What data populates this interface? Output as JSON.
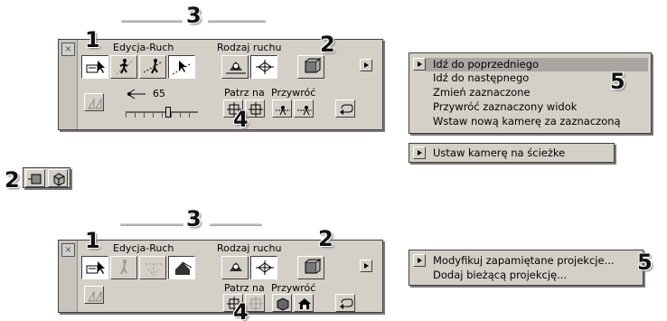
{
  "annotations": {
    "n1_top": "1",
    "n2_top": "2",
    "n3_top": "3",
    "n4_top": "4",
    "n5_top": "5",
    "n2_mid": "2",
    "n1_bot": "1",
    "n2_bot": "2",
    "n3_bot": "3",
    "n4_bot": "4",
    "n5_bot": "5"
  },
  "palette_top": {
    "group_edit": "Edycja-Ruch",
    "group_motion": "Rodzaj ruchu",
    "look_at": "Patrz na",
    "restore": "Przywróć",
    "angle_value": "65",
    "close": "×"
  },
  "palette_bottom": {
    "group_edit": "Edycja-Ruch",
    "group_motion": "Rodzaj ruchu",
    "look_at": "Patrz na",
    "restore": "Przywróć",
    "close": "×"
  },
  "menu_camera": {
    "items": [
      "Idź do poprzedniego",
      "Idź do następnego",
      "Zmień zaznaczone",
      "Przywróć zaznaczony widok",
      "Wstaw nową kamerę za zaznaczoną"
    ],
    "selected_index": 0
  },
  "menu_path": {
    "item": "Ustaw kamerę na ścieżke"
  },
  "menu_projection": {
    "items": [
      "Modyfikuj zapamiętane projekcje...",
      "Dodaj bieżącą projekcję..."
    ]
  },
  "slider": {
    "level": 0.6
  }
}
